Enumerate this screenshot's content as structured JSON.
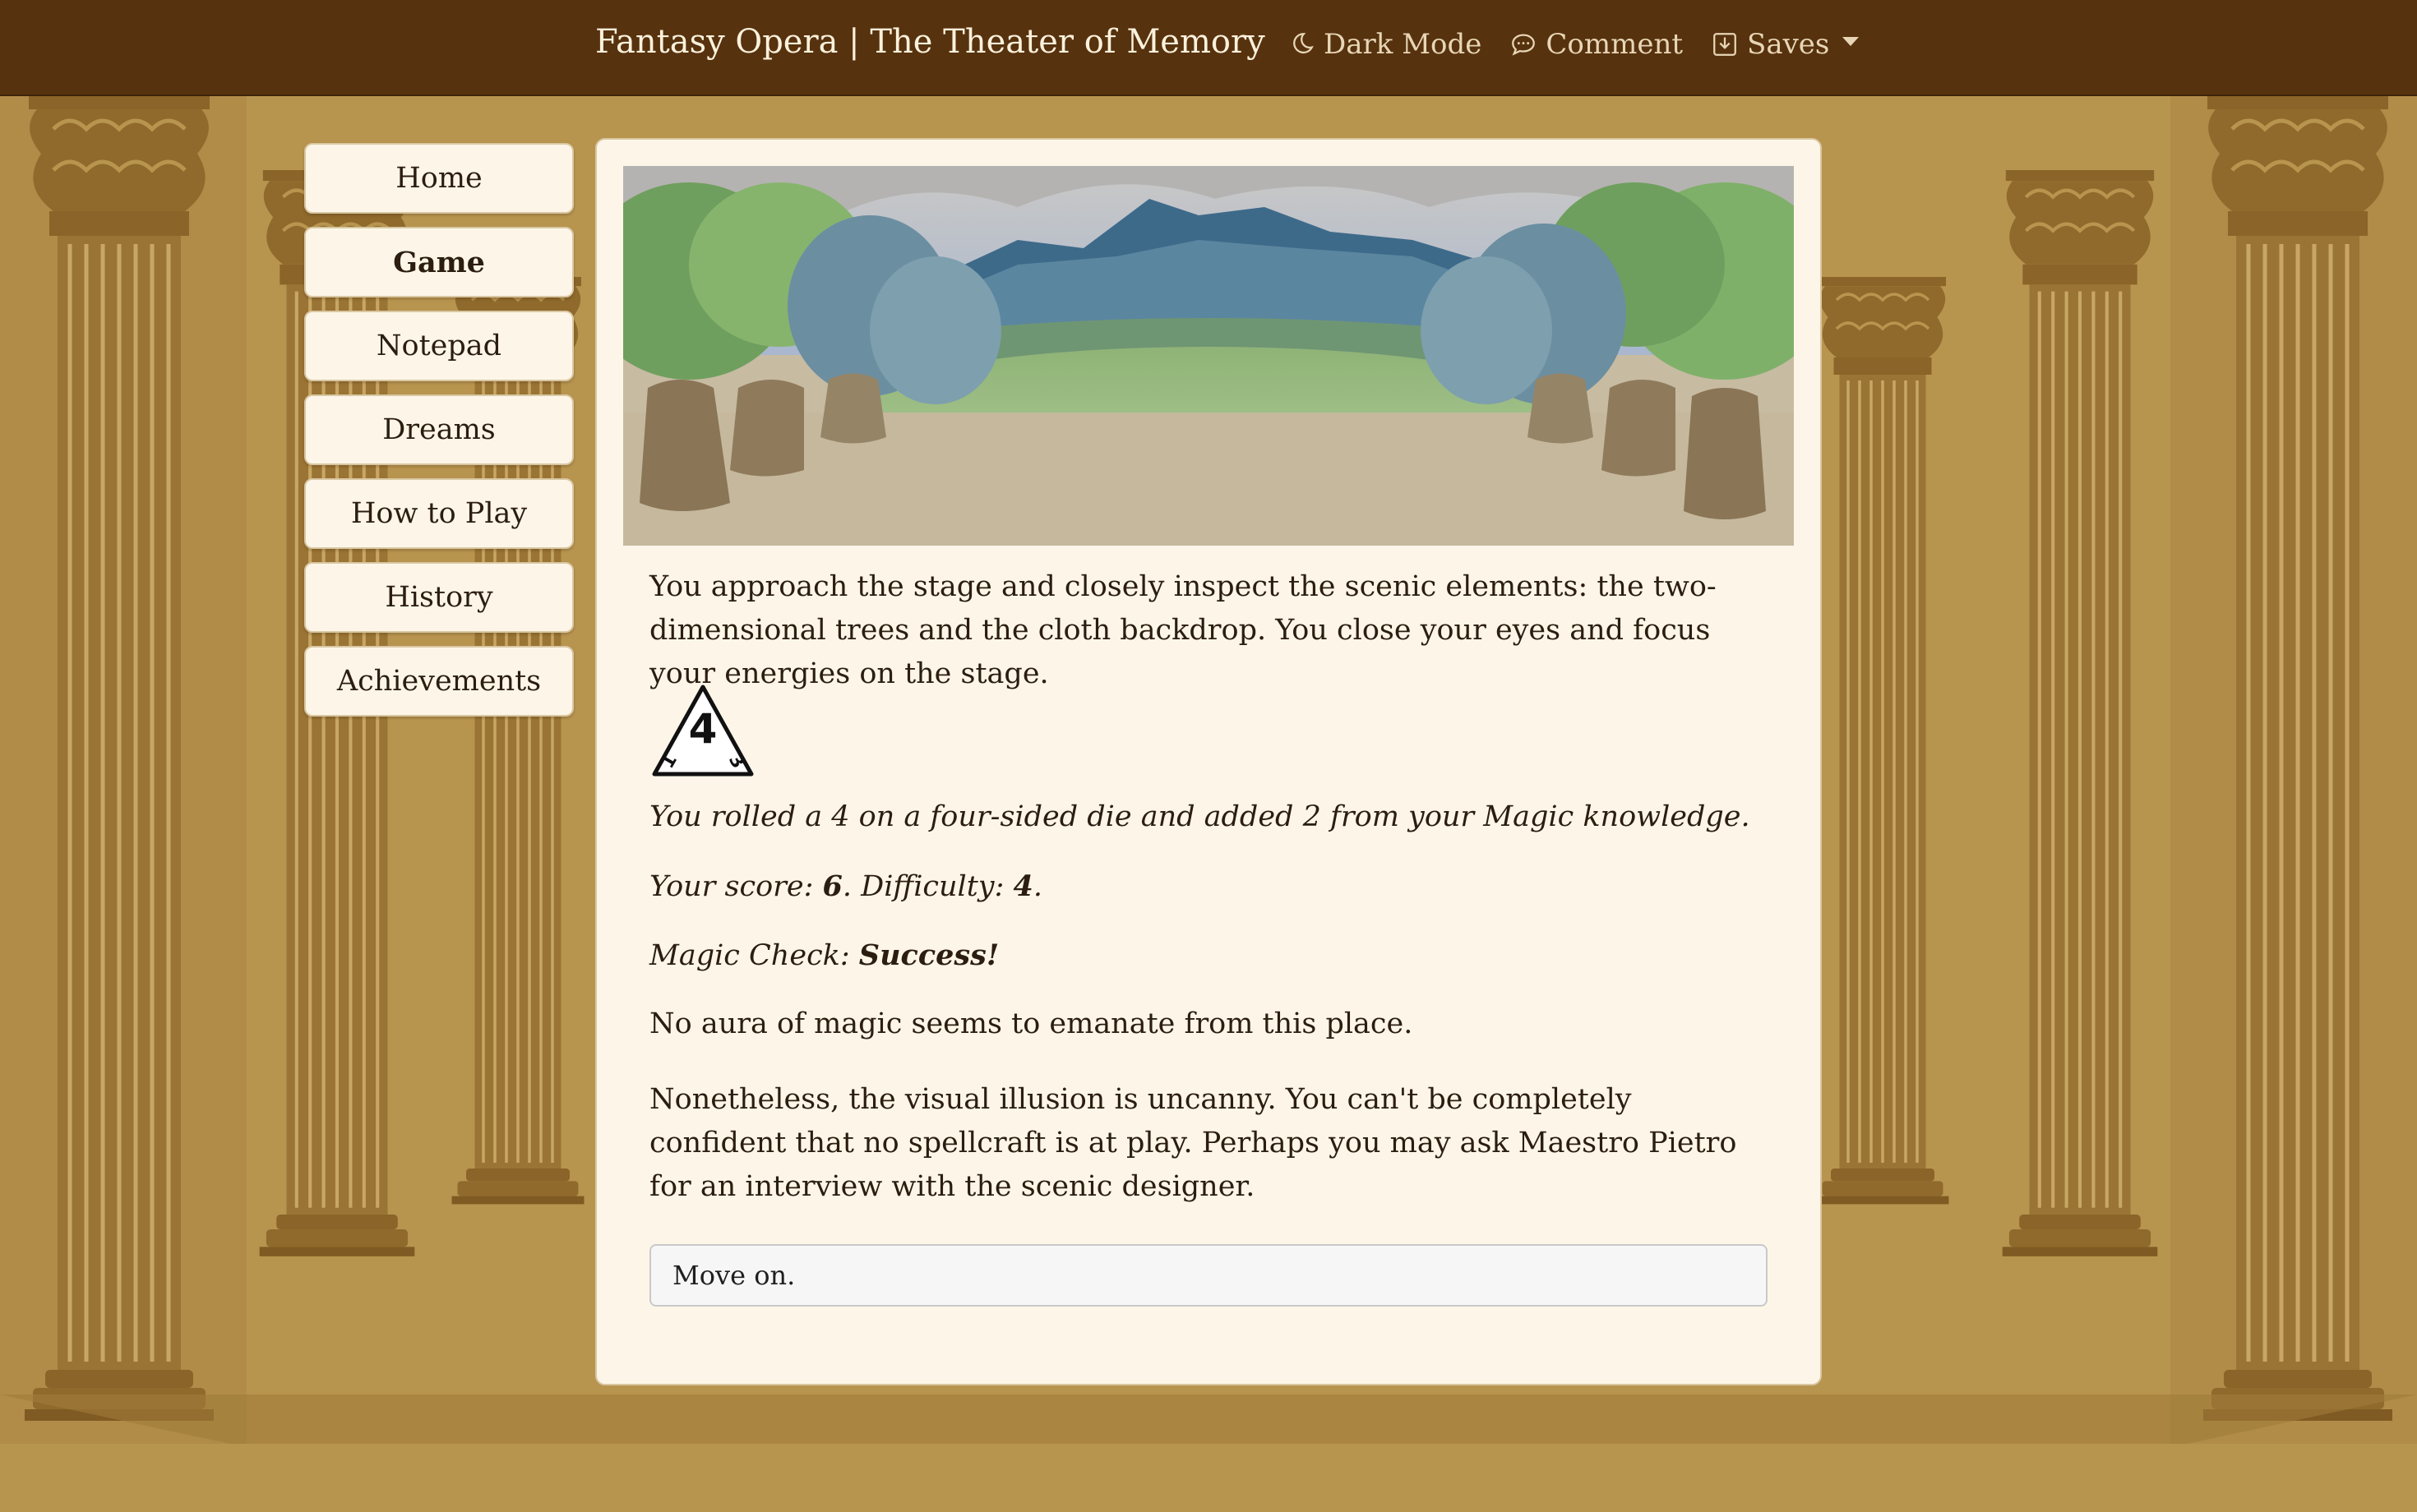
{
  "navbar": {
    "brand": "Fantasy Opera | The Theater of Memory",
    "dark_mode_label": "Dark Mode",
    "comment_label": "Comment",
    "saves_label": "Saves",
    "icons": [
      "moon-icon",
      "chat-bubble-icon",
      "save-download-icon",
      "chevron-down-icon"
    ]
  },
  "sidebar": {
    "items": [
      {
        "label": "Home",
        "active": false
      },
      {
        "label": "Game",
        "active": true
      },
      {
        "label": "Notepad",
        "active": false
      },
      {
        "label": "Dreams",
        "active": false
      },
      {
        "label": "How to Play",
        "active": false
      },
      {
        "label": "History",
        "active": false
      },
      {
        "label": "Achievements",
        "active": false
      }
    ]
  },
  "main": {
    "intro": "You approach the stage and closely inspect the scenic elements: the two-dimensional trees and the cloth backdrop. You close your eyes and focus your energies on the stage.",
    "die": {
      "top": "4",
      "left": "1",
      "right": "3"
    },
    "roll_text": "You rolled a 4 on a four-sided die and added 2 from your Magic knowledge.",
    "score_prefix": "Your score: ",
    "score": "6",
    "difficulty_prefix": ". Difficulty: ",
    "difficulty": "4",
    "score_suffix": ".",
    "check_prefix": "Magic Check: ",
    "check_result": "Success!",
    "aura_text": "No aura of magic seems to emanate from this place.",
    "illusion_text": "Nonetheless, the visual illusion is uncanny. You can't be completely confident that no spellcraft is at play. Perhaps you may ask Maestro Pietro for an interview with the scenic designer.",
    "choice_label": "Move on."
  },
  "colors": {
    "navbar": "#57320e",
    "background": "#b8954f",
    "column": "#9a7434",
    "card": "#fdf6e8",
    "text": "#2b1e10"
  }
}
